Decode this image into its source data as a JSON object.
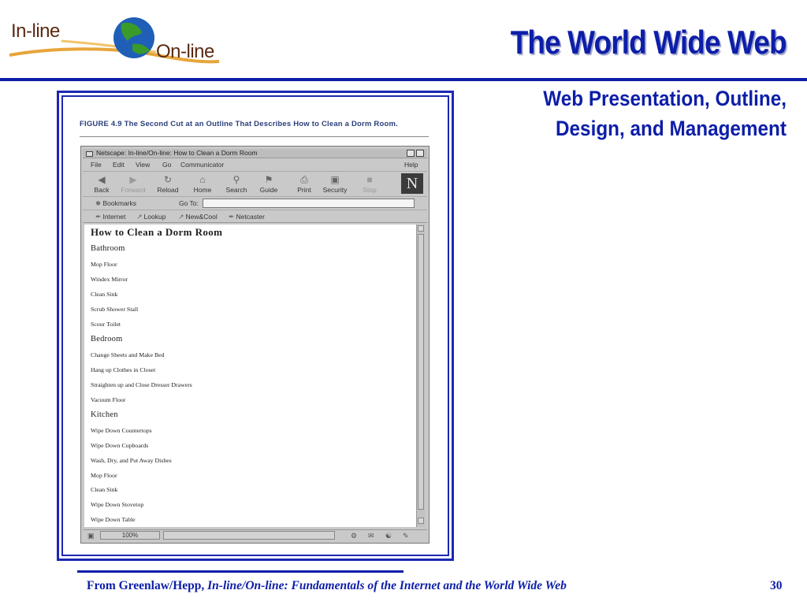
{
  "logo": {
    "text_inline": "In-line",
    "text_online": "On-line"
  },
  "slide": {
    "title": "The World Wide Web",
    "subtitle_line1": "Web Presentation, Outline,",
    "subtitle_line2": "Design, and Management",
    "page_number": "30"
  },
  "figure": {
    "caption": "FIGURE 4.9  The Second Cut at an Outline That Describes How to Clean a Dorm Room."
  },
  "browser": {
    "title": "Netscape: In-line/On-line: How to Clean a Dorm Room",
    "menu": [
      "File",
      "Edit",
      "View",
      "Go",
      "Communicator"
    ],
    "help": "Help",
    "toolbar": [
      {
        "label": "Back",
        "icon": "back-arrow-icon",
        "enabled": true
      },
      {
        "label": "Forward",
        "icon": "forward-arrow-icon",
        "enabled": false
      },
      {
        "label": "Reload",
        "icon": "reload-icon",
        "enabled": true
      },
      {
        "label": "Home",
        "icon": "home-icon",
        "enabled": true
      },
      {
        "label": "Search",
        "icon": "search-icon",
        "enabled": true
      },
      {
        "label": "Guide",
        "icon": "guide-icon",
        "enabled": true
      },
      {
        "label": "Print",
        "icon": "print-icon",
        "enabled": true
      },
      {
        "label": "Security",
        "icon": "lock-icon",
        "enabled": true
      },
      {
        "label": "Stop",
        "icon": "stop-icon",
        "enabled": false
      }
    ],
    "bookmarks_label": "Bookmarks",
    "goto_label": "Go To:",
    "goto_value": "",
    "personal_toolbar": [
      "Internet",
      "Lookup",
      "New&Cool",
      "Netcaster"
    ],
    "zoom": "100%",
    "page": {
      "heading": "How to Clean a Dorm Room",
      "sections": [
        {
          "title": "Bathroom",
          "items": [
            "Mop Floor",
            "Windex Mirror",
            "Clean Sink",
            "Scrub Shower Stall",
            "Scour Toilet"
          ]
        },
        {
          "title": "Bedroom",
          "items": [
            "Change Sheets and Make Bed",
            "Hang up Clothes in Closet",
            "Straighten up and Close Dresser Drawers",
            "Vacuum Floor"
          ]
        },
        {
          "title": "Kitchen",
          "items": [
            "Wipe Down Countertops",
            "Wipe Down Cupboards",
            "Wash, Dry, and Put Away Dishes",
            "Mop Floor",
            "Clean Sink",
            "Wipe Down Stovetop",
            "Wipe Down Table"
          ]
        }
      ]
    }
  },
  "footer": {
    "prefix": "From Greenlaw/Hepp, ",
    "book_title": "In-line/On-line: Fundamentals of the Internet and the World Wide Web"
  },
  "colors": {
    "title_blue": "#0d1ea8",
    "logo_brown": "#5a2a12",
    "frame_blue": "#1c27b4"
  }
}
